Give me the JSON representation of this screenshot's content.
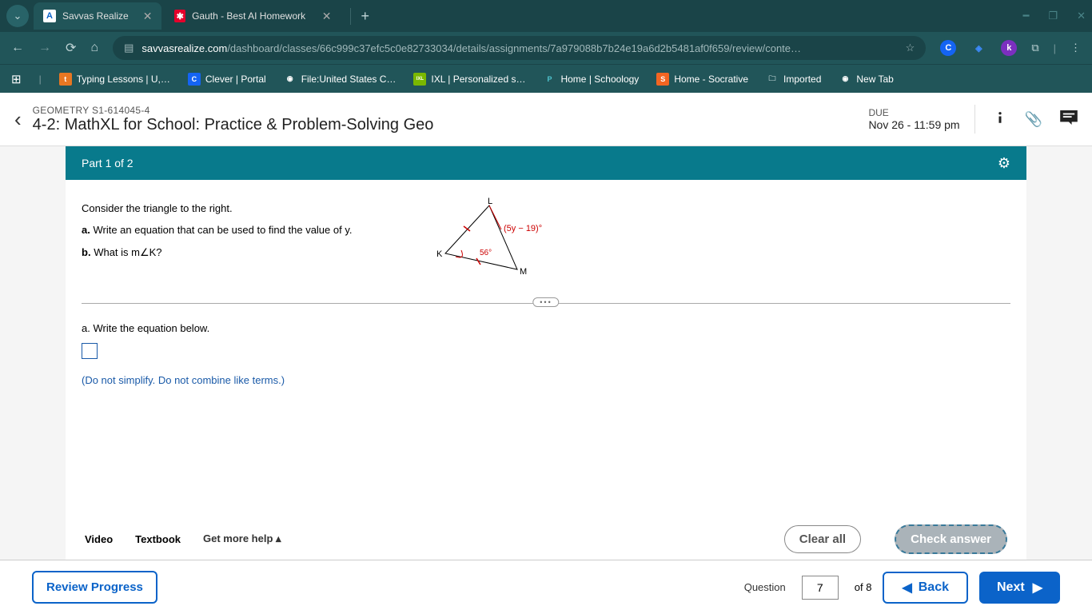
{
  "browser": {
    "tabs": [
      {
        "title": "Savvas Realize",
        "favicon_bg": "#fff",
        "favicon_fg": "#0b63c9",
        "favicon_char": "A",
        "active": true
      },
      {
        "title": "Gauth - Best AI Homework Help",
        "favicon_bg": "#e4002b",
        "favicon_fg": "#fff",
        "favicon_char": "✱",
        "active": false
      }
    ],
    "url_domain": "savvasrealize.com",
    "url_path": "/dashboard/classes/66c999c37efc5c0e82733034/details/assignments/7a979088b7b24e19a6d2b5481af0f659/review/conte…",
    "bookmarks": [
      {
        "label": "Typing Lessons | U,…",
        "icon_bg": "#e87722",
        "icon_char": "t"
      },
      {
        "label": "Clever | Portal",
        "icon_bg": "#1464f4",
        "icon_char": "C"
      },
      {
        "label": "File:United States C…",
        "icon_bg": "#555",
        "icon_char": "◉"
      },
      {
        "label": "IXL | Personalized s…",
        "icon_bg": "#7ab800",
        "icon_char": "IXL"
      },
      {
        "label": "Home | Schoology",
        "icon_bg": "#333",
        "icon_char": "P"
      },
      {
        "label": "Home - Socrative",
        "icon_bg": "#f26522",
        "icon_char": "S"
      },
      {
        "label": "Imported",
        "icon_bg": "transparent",
        "icon_char": "🗀"
      },
      {
        "label": "New Tab",
        "icon_bg": "#555",
        "icon_char": "◉"
      }
    ]
  },
  "header": {
    "breadcrumb": "GEOMETRY S1-614045-4",
    "title": "4-2: MathXL for School: Practice & Problem-Solving Geo",
    "due_label": "DUE",
    "due_value": "Nov 26 - 11:59 pm"
  },
  "part": {
    "label": "Part 1 of 2"
  },
  "problem": {
    "intro": "Consider the triangle to the right.",
    "a_label": "a.",
    "a_text": "Write an equation that can be used to find the value of y.",
    "b_label": "b.",
    "b_text": "What is m∠K?",
    "diagram": {
      "vertex_L": "L",
      "vertex_K": "K",
      "vertex_M": "M",
      "angle_ext": "(5y − 19)°",
      "angle_int": "56°"
    },
    "answer_a_label": "a.",
    "answer_a_text": "Write the equation below.",
    "hint": "(Do not simplify. Do not combine like terms.)"
  },
  "help": {
    "video": "Video",
    "textbook": "Textbook",
    "more": "Get more help",
    "clear": "Clear all",
    "check": "Check answer"
  },
  "footer": {
    "review": "Review Progress",
    "q_label": "Question",
    "q_current": "7",
    "q_of": "of 8",
    "back": "Back",
    "next": "Next"
  }
}
